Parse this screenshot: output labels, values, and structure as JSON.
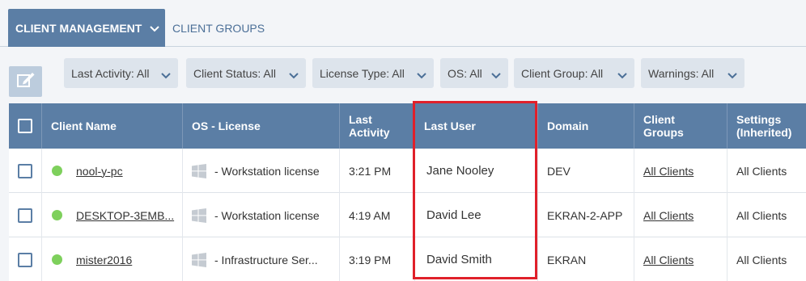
{
  "tabs": {
    "client_management": "CLIENT MANAGEMENT",
    "client_groups": "CLIENT GROUPS"
  },
  "filters": [
    {
      "label": "Last Activity: All"
    },
    {
      "label": "Client Status: All"
    },
    {
      "label": "License Type: All"
    },
    {
      "label": "OS: All"
    },
    {
      "label": "Client Group: All"
    },
    {
      "label": "Warnings: All"
    }
  ],
  "table": {
    "headers": {
      "client_name": "Client Name",
      "os_license": "OS - License",
      "last_activity_1": "Last",
      "last_activity_2": "Activity",
      "last_user": "Last User",
      "domain": "Domain",
      "client_groups_1": "Client",
      "client_groups_2": "Groups",
      "settings_1": "Settings",
      "settings_2": "(Inherited)"
    },
    "rows": [
      {
        "client_name": "nool-y-pc",
        "os_license": "- Workstation license",
        "last_activity": "3:21 PM",
        "last_user": "Jane Nooley",
        "domain": "DEV",
        "client_groups": "All Clients",
        "settings": "All Clients"
      },
      {
        "client_name": "DESKTOP-3EMB...",
        "os_license": "- Workstation license",
        "last_activity": "4:19 AM",
        "last_user": "David Lee",
        "domain": "EKRAN-2-APP",
        "client_groups": "All Clients",
        "settings": "All Clients"
      },
      {
        "client_name": "mister2016",
        "os_license": "- Infrastructure Ser...",
        "last_activity": "3:19 PM",
        "last_user": "David Smith",
        "domain": "EKRAN",
        "client_groups": "All Clients",
        "settings": "All Clients"
      }
    ]
  },
  "colors": {
    "header_blue": "#5b7ea5",
    "online_green": "#7ed05c",
    "highlight_red": "#e0202a"
  },
  "icons": {
    "tab_dropdown": "chevron-down-icon",
    "edit": "edit-icon",
    "os": "windows-icon",
    "status": "online-status-dot"
  }
}
